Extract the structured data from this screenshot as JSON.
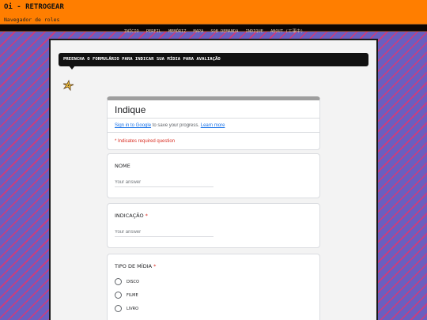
{
  "site": {
    "title": "Oi - RETROGEAR",
    "subtitle": "Navegador de roles"
  },
  "nav": {
    "items": [
      "INÍCIO",
      "PERFIL",
      "MEMÓRIZ",
      "MAPA",
      "SOB DEMANDA",
      "INDIQUE",
      "ABOUT (工事中)"
    ]
  },
  "banner": {
    "text": "PREENCHA O FORMULÁRIO PARA INDICAR SUA MÍDIA PARA AVALIAÇÃO"
  },
  "form": {
    "title": "Indique",
    "signin_link": "Sign in to Google",
    "signin_text": " to save your progress. ",
    "learn_more": "Learn more",
    "required_note": "* Indicates required question",
    "questions": [
      {
        "label": "NOME",
        "required": "",
        "placeholder": "Your answer"
      },
      {
        "label": "INDICAÇÃO",
        "required": "*",
        "placeholder": "Your answer"
      },
      {
        "label": "TIPO DE MÍDIA",
        "required": "*",
        "options": [
          "DISCO",
          "FILME",
          "LIVRO"
        ]
      }
    ]
  },
  "colors": {
    "topbar": "#ff7e00",
    "navbar": "#0c0602",
    "background_stripe_a": "#6a5fbf",
    "background_stripe_b": "#d33a78",
    "required": "#d93025",
    "link": "#1a73e8"
  }
}
